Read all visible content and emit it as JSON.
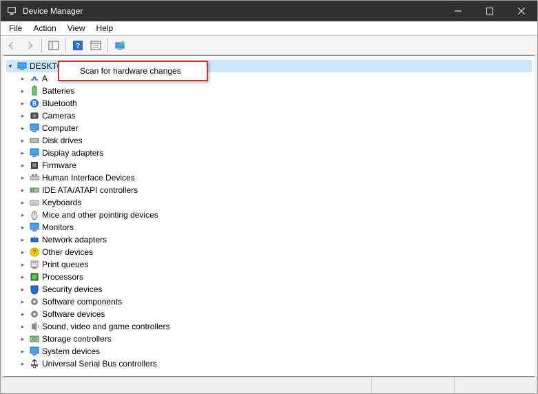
{
  "window": {
    "title": "Device Manager"
  },
  "menubar": {
    "file": "File",
    "action": "Action",
    "view": "View",
    "help": "Help"
  },
  "tree": {
    "root": "DESKTOP",
    "items": [
      {
        "label": "A"
      },
      {
        "label": "Batteries"
      },
      {
        "label": "Bluetooth"
      },
      {
        "label": "Cameras"
      },
      {
        "label": "Computer"
      },
      {
        "label": "Disk drives"
      },
      {
        "label": "Display adapters"
      },
      {
        "label": "Firmware"
      },
      {
        "label": "Human Interface Devices"
      },
      {
        "label": "IDE ATA/ATAPI controllers"
      },
      {
        "label": "Keyboards"
      },
      {
        "label": "Mice and other pointing devices"
      },
      {
        "label": "Monitors"
      },
      {
        "label": "Network adapters"
      },
      {
        "label": "Other devices"
      },
      {
        "label": "Print queues"
      },
      {
        "label": "Processors"
      },
      {
        "label": "Security devices"
      },
      {
        "label": "Software components"
      },
      {
        "label": "Software devices"
      },
      {
        "label": "Sound, video and game controllers"
      },
      {
        "label": "Storage controllers"
      },
      {
        "label": "System devices"
      },
      {
        "label": "Universal Serial Bus controllers"
      }
    ]
  },
  "context_menu": {
    "scan": "Scan for hardware changes"
  },
  "icons": {
    "audio": "🔊",
    "battery": "🔋",
    "bluetooth": "bt",
    "camera": "📷",
    "computer": "🖥",
    "disk": "💿",
    "display": "🖥",
    "firmware": "fw",
    "hid": "hid",
    "ide": "ide",
    "keyboard": "⌨",
    "mouse": "🖱",
    "monitor": "🖥",
    "network": "nw",
    "other": "?",
    "print": "🖨",
    "cpu": "▦",
    "security": "🛡",
    "swcomp": "⚙",
    "swdev": "⚙",
    "sound": "🔈",
    "storage": "st",
    "system": "🖥",
    "usb": "🔌"
  }
}
